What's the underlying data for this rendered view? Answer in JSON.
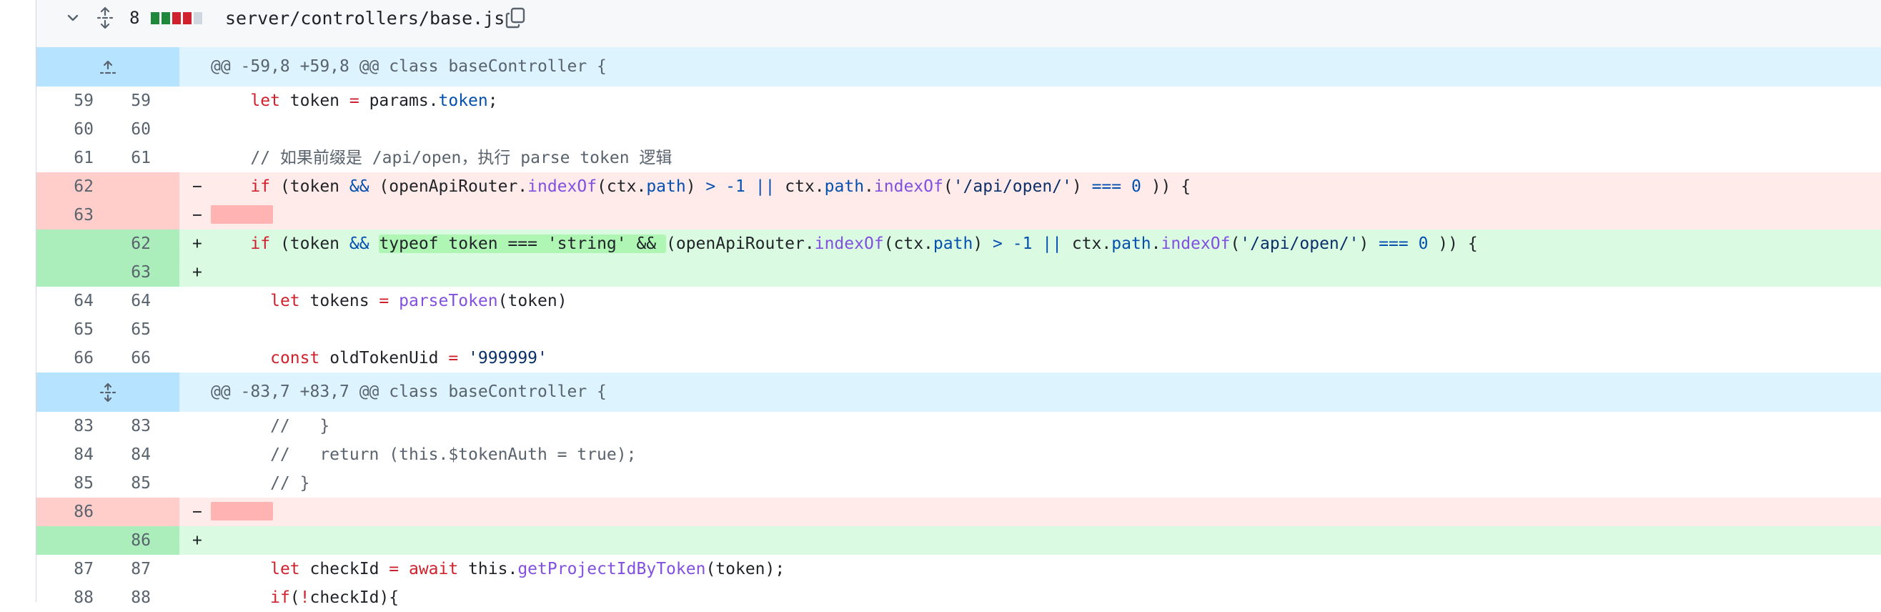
{
  "file": {
    "changes_count": "8",
    "diffstat": [
      "#1f883d",
      "#1f883d",
      "#cf222e",
      "#cf222e",
      "#d0d7de"
    ],
    "filename": "server/controllers/base.js"
  },
  "icons": {
    "collapse": "chevron-down-icon",
    "expand_all": "unfold-icon",
    "copy": "copy-icon",
    "expand_up": "fold-up-icon",
    "expand_both": "unfold-icon"
  },
  "colors": {
    "hunk_bg": "#ddf4ff",
    "hunk_num_bg": "#b6e3ff",
    "del_bg": "#ffebe9",
    "del_num_bg": "#ffcecb",
    "add_bg": "#dafbe1",
    "add_num_bg": "#aceebb",
    "keyword": "#cf222e",
    "property": "#0550ae",
    "function": "#8250df",
    "string": "#0a3069"
  },
  "rows": [
    {
      "type": "hunk",
      "text": "@@ -59,8 +59,8 @@ class baseController {"
    },
    {
      "type": "ctx",
      "old": "59",
      "new": "59",
      "code": [
        {
          "t": "    ",
          "c": "t"
        },
        {
          "t": "let",
          "c": "k"
        },
        {
          "t": " token ",
          "c": "t"
        },
        {
          "t": "=",
          "c": "k"
        },
        {
          "t": " params.",
          "c": "t"
        },
        {
          "t": "token",
          "c": "p"
        },
        {
          "t": ";",
          "c": "t"
        }
      ]
    },
    {
      "type": "ctx",
      "old": "60",
      "new": "60",
      "code": []
    },
    {
      "type": "ctx",
      "old": "61",
      "new": "61",
      "code": [
        {
          "t": "    // 如果前缀是 /api/open，执行 parse token 逻辑",
          "c": "c"
        }
      ]
    },
    {
      "type": "del",
      "old": "62",
      "new": "",
      "marker": "−",
      "code": [
        {
          "t": "    ",
          "c": "t"
        },
        {
          "t": "if",
          "c": "k"
        },
        {
          "t": " (token ",
          "c": "t"
        },
        {
          "t": "&&",
          "c": "p"
        },
        {
          "t": " (openApiRouter.",
          "c": "t"
        },
        {
          "t": "indexOf",
          "c": "f"
        },
        {
          "t": "(ctx.",
          "c": "t"
        },
        {
          "t": "path",
          "c": "p"
        },
        {
          "t": ") ",
          "c": "t"
        },
        {
          "t": ">",
          "c": "p"
        },
        {
          "t": " ",
          "c": "t"
        },
        {
          "t": "-1",
          "c": "p"
        },
        {
          "t": " ",
          "c": "t"
        },
        {
          "t": "||",
          "c": "p"
        },
        {
          "t": " ctx.",
          "c": "t"
        },
        {
          "t": "path",
          "c": "p"
        },
        {
          "t": ".",
          "c": "t"
        },
        {
          "t": "indexOf",
          "c": "f"
        },
        {
          "t": "(",
          "c": "t"
        },
        {
          "t": "'/api/open/'",
          "c": "s"
        },
        {
          "t": ") ",
          "c": "t"
        },
        {
          "t": "===",
          "c": "p"
        },
        {
          "t": " ",
          "c": "t"
        },
        {
          "t": "0",
          "c": "p"
        },
        {
          "t": " )) {",
          "c": "t"
        }
      ]
    },
    {
      "type": "del",
      "old": "63",
      "new": "",
      "marker": "−",
      "ws": true,
      "code": []
    },
    {
      "type": "add",
      "old": "",
      "new": "62",
      "marker": "+",
      "code": [
        {
          "t": "    ",
          "c": "t"
        },
        {
          "t": "if",
          "c": "k"
        },
        {
          "t": " (token ",
          "c": "t"
        },
        {
          "t": "&&",
          "c": "p"
        },
        {
          "t": " ",
          "c": "t"
        },
        {
          "t": "typeof token === 'string' && ",
          "c": "t",
          "hl": true
        },
        {
          "t": "(openApiRouter.",
          "c": "t"
        },
        {
          "t": "indexOf",
          "c": "f"
        },
        {
          "t": "(ctx.",
          "c": "t"
        },
        {
          "t": "path",
          "c": "p"
        },
        {
          "t": ") ",
          "c": "t"
        },
        {
          "t": ">",
          "c": "p"
        },
        {
          "t": " ",
          "c": "t"
        },
        {
          "t": "-1",
          "c": "p"
        },
        {
          "t": " ",
          "c": "t"
        },
        {
          "t": "||",
          "c": "p"
        },
        {
          "t": " ctx.",
          "c": "t"
        },
        {
          "t": "path",
          "c": "p"
        },
        {
          "t": ".",
          "c": "t"
        },
        {
          "t": "indexOf",
          "c": "f"
        },
        {
          "t": "(",
          "c": "t"
        },
        {
          "t": "'/api/open/'",
          "c": "s"
        },
        {
          "t": ") ",
          "c": "t"
        },
        {
          "t": "===",
          "c": "p"
        },
        {
          "t": " ",
          "c": "t"
        },
        {
          "t": "0",
          "c": "p"
        },
        {
          "t": " )) {",
          "c": "t"
        }
      ]
    },
    {
      "type": "add",
      "old": "",
      "new": "63",
      "marker": "+",
      "code": []
    },
    {
      "type": "ctx",
      "old": "64",
      "new": "64",
      "code": [
        {
          "t": "      ",
          "c": "t"
        },
        {
          "t": "let",
          "c": "k"
        },
        {
          "t": " tokens ",
          "c": "t"
        },
        {
          "t": "=",
          "c": "k"
        },
        {
          "t": " ",
          "c": "t"
        },
        {
          "t": "parseToken",
          "c": "f"
        },
        {
          "t": "(token)",
          "c": "t"
        }
      ]
    },
    {
      "type": "ctx",
      "old": "65",
      "new": "65",
      "code": []
    },
    {
      "type": "ctx",
      "old": "66",
      "new": "66",
      "code": [
        {
          "t": "      ",
          "c": "t"
        },
        {
          "t": "const",
          "c": "k"
        },
        {
          "t": " oldTokenUid ",
          "c": "t"
        },
        {
          "t": "=",
          "c": "k"
        },
        {
          "t": " ",
          "c": "t"
        },
        {
          "t": "'999999'",
          "c": "s"
        }
      ]
    },
    {
      "type": "hunk",
      "text": "@@ -83,7 +83,7 @@ class baseController {"
    },
    {
      "type": "ctx",
      "old": "83",
      "new": "83",
      "code": [
        {
          "t": "      //   }",
          "c": "c"
        }
      ]
    },
    {
      "type": "ctx",
      "old": "84",
      "new": "84",
      "code": [
        {
          "t": "      //   return (this.$tokenAuth = true);",
          "c": "c"
        }
      ]
    },
    {
      "type": "ctx",
      "old": "85",
      "new": "85",
      "code": [
        {
          "t": "      // }",
          "c": "c"
        }
      ]
    },
    {
      "type": "del",
      "old": "86",
      "new": "",
      "marker": "−",
      "ws": true,
      "code": []
    },
    {
      "type": "add",
      "old": "",
      "new": "86",
      "marker": "+",
      "code": []
    },
    {
      "type": "ctx",
      "old": "87",
      "new": "87",
      "code": [
        {
          "t": "      ",
          "c": "t"
        },
        {
          "t": "let",
          "c": "k"
        },
        {
          "t": " checkId ",
          "c": "t"
        },
        {
          "t": "=",
          "c": "k"
        },
        {
          "t": " ",
          "c": "t"
        },
        {
          "t": "await",
          "c": "k"
        },
        {
          "t": " this.",
          "c": "t"
        },
        {
          "t": "getProjectIdByToken",
          "c": "f"
        },
        {
          "t": "(token);",
          "c": "t"
        }
      ]
    },
    {
      "type": "ctx",
      "old": "88",
      "new": "88",
      "code": [
        {
          "t": "      ",
          "c": "t"
        },
        {
          "t": "if",
          "c": "k"
        },
        {
          "t": "(",
          "c": "t"
        },
        {
          "t": "!",
          "c": "k"
        },
        {
          "t": "checkId){",
          "c": "t"
        }
      ]
    }
  ]
}
